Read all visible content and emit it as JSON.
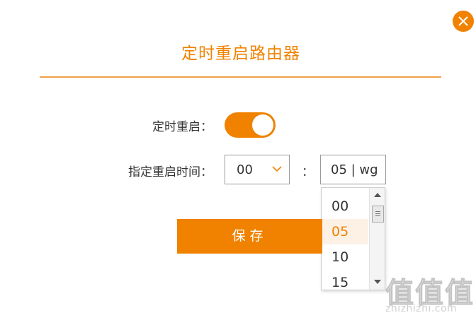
{
  "dialog": {
    "title": "定时重启路由器",
    "close_icon": "close-icon"
  },
  "form": {
    "timer_label": "定时重启：",
    "timer_enabled": true,
    "time_label": "指定重启时间：",
    "hour_value": "00",
    "colon": "：",
    "minute_value": "05 | wg",
    "minute_options": [
      "00",
      "05",
      "10",
      "15"
    ],
    "minute_selected": "05"
  },
  "actions": {
    "save_label": "保存"
  },
  "watermark": {
    "url": "zhizhizhi.com"
  },
  "colors": {
    "accent": "#f08200",
    "selected_bg": "#fdf1e6"
  }
}
